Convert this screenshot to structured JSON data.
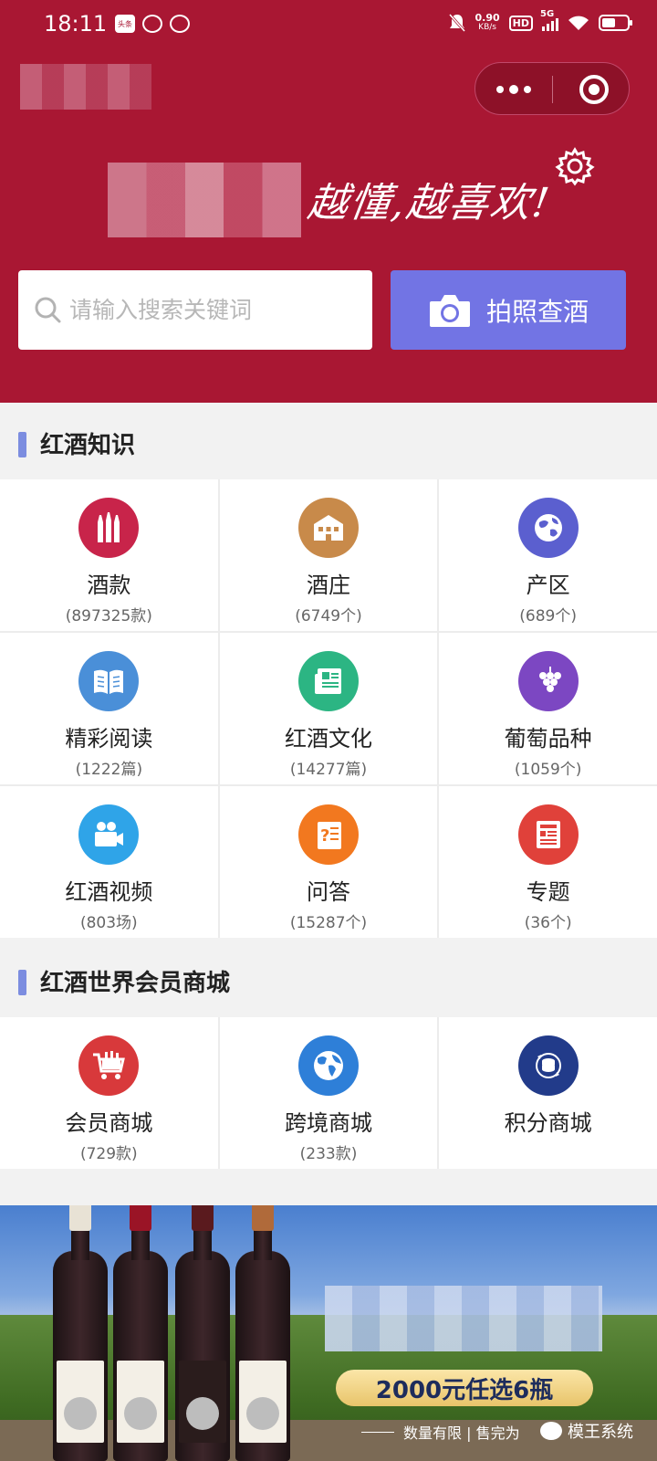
{
  "status_bar": {
    "time": "18:11",
    "net_speed_value": "0.90",
    "net_speed_unit": "KB/s",
    "hd": "HD",
    "network": "5G",
    "app_badge": "头条"
  },
  "header": {
    "slogan": "越懂,越喜欢!",
    "search_placeholder": "请输入搜索关键词",
    "photo_button_label": "拍照查酒",
    "accent_color": "#a91733",
    "button_color": "#7274e4"
  },
  "sections": {
    "knowledge": {
      "title": "红酒知识",
      "items": [
        {
          "label": "酒款",
          "count": "(897325款)",
          "icon": "wine-bottles-icon",
          "color": "#c8244a"
        },
        {
          "label": "酒庄",
          "count": "(6749个)",
          "icon": "winery-building-icon",
          "color": "#c88a4a"
        },
        {
          "label": "产区",
          "count": "(689个)",
          "icon": "globe-icon",
          "color": "#5b5fcf"
        },
        {
          "label": "精彩阅读",
          "count": "(1222篇)",
          "icon": "book-icon",
          "color": "#4a8fd8"
        },
        {
          "label": "红酒文化",
          "count": "(14277篇)",
          "icon": "newspaper-icon",
          "color": "#2cb583"
        },
        {
          "label": "葡萄品种",
          "count": "(1059个)",
          "icon": "grape-icon",
          "color": "#7c47c2"
        },
        {
          "label": "红酒视频",
          "count": "(803场)",
          "icon": "video-camera-icon",
          "color": "#2fa4e8"
        },
        {
          "label": "问答",
          "count": "(15287个)",
          "icon": "qa-icon",
          "color": "#f2781f"
        },
        {
          "label": "专题",
          "count": "(36个)",
          "icon": "topic-icon",
          "color": "#e0413a"
        }
      ]
    },
    "mall": {
      "title": "红酒世界会员商城",
      "items": [
        {
          "label": "会员商城",
          "count": "(729款)",
          "icon": "shopping-cart-icon",
          "color": "#d8393b"
        },
        {
          "label": "跨境商城",
          "count": "(233款)",
          "icon": "world-map-icon",
          "color": "#2e7fd8"
        },
        {
          "label": "积分商城",
          "count": "",
          "icon": "points-coin-icon",
          "color": "#223b8a"
        }
      ]
    }
  },
  "banner": {
    "promo": "2000元任选6瓶",
    "tagline": "数量有限 | 售完为",
    "watermark": "模王系统"
  }
}
